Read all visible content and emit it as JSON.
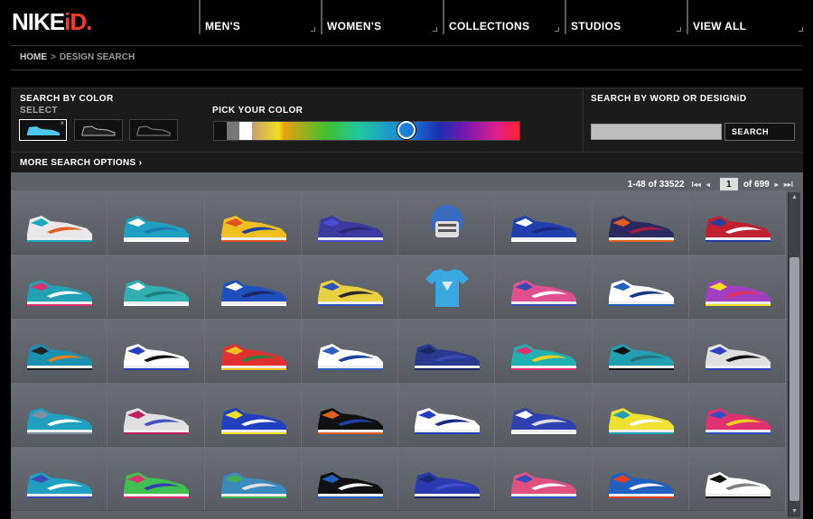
{
  "header": {
    "logo_main": "NIKE",
    "logo_accent": "iD.",
    "nav": [
      "MEN'S",
      "WOMEN'S",
      "COLLECTIONS",
      "STUDIOS",
      "VIEW ALL"
    ]
  },
  "breadcrumb": {
    "home": "HOME",
    "sep": ">",
    "current": "DESIGN SEARCH"
  },
  "search_panel": {
    "color_title": "SEARCH BY COLOR",
    "select_label": "SELECT",
    "swatches": [
      "light-blue-shoe-swatch",
      "grey-shoe-swatch",
      "black-shoe-swatch"
    ],
    "pick_label": "PICK YOUR COLOR",
    "word_title": "SEARCH BY WORD OR DESIGNiD",
    "search_value": "",
    "search_button": "SEARCH",
    "more_options": "MORE SEARCH OPTIONS",
    "more_options_chevron": "›"
  },
  "results": {
    "range": "1-48 of 33522",
    "first_icon": "I◂◂",
    "prev_icon": "◂",
    "page": "1",
    "of_pages": "of 699",
    "next_icon": "▸",
    "last_icon": "▸▸I"
  },
  "products": [
    [
      "#e8e8e8",
      "#1aa8c0",
      "#e06020"
    ],
    [
      "#20a0c0",
      "#ffffff",
      "#1a7fb0"
    ],
    [
      "#f0c020",
      "#e05020",
      "#2040a0"
    ],
    [
      "#3a3aa0",
      "#4c4cd0",
      "#2a2a70"
    ],
    [
      "#c0c8d0",
      "#2060c0",
      "#ffffff"
    ],
    [
      "#2040b0",
      "#ffffff",
      "#1a2a80"
    ],
    [
      "#2a2a60",
      "#e06020",
      "#a02040"
    ],
    [
      "#c02030",
      "#2040a0",
      "#ffffff"
    ],
    [
      "#20a0b0",
      "#e03070",
      "#ffffff"
    ],
    [
      "#30b0b0",
      "#ffffff",
      "#1a8080"
    ],
    [
      "#2050c0",
      "#ffffff",
      "#1a2a60"
    ],
    [
      "#e8d040",
      "#3050c0",
      "#2a2a2a"
    ],
    [
      "#40b0e0",
      "#1a8ac0",
      "#ffffff"
    ],
    [
      "#e05090",
      "#3a4ab0",
      "#ffffff"
    ],
    [
      "#ffffff",
      "#2060c0",
      "#1a3a80"
    ],
    [
      "#a040c0",
      "#f0e020",
      "#e03060"
    ],
    [
      "#1a90b0",
      "#222222",
      "#e08020"
    ],
    [
      "#ffffff",
      "#2a40c0",
      "#111111"
    ],
    [
      "#e03030",
      "#f0c020",
      "#2a8040"
    ],
    [
      "#ffffff",
      "#3060c0",
      "#2040a0"
    ],
    [
      "#2a3a90",
      "#1a2a60",
      "#3a4ab0"
    ],
    [
      "#20b0b0",
      "#e03070",
      "#f0d020"
    ],
    [
      "#20a0b0",
      "#111111",
      "#2a7080"
    ],
    [
      "#e0e0e0",
      "#3040c0",
      "#111111"
    ],
    [
      "#20a0c0",
      "#8090a0",
      "#ffffff"
    ],
    [
      "#e0e0e0",
      "#c02060",
      "#4050c0"
    ],
    [
      "#2040c0",
      "#f0e020",
      "#ffffff"
    ],
    [
      "#111111",
      "#e06020",
      "#2040a0"
    ],
    [
      "#ffffff",
      "#2040c0",
      "#1a2a80"
    ],
    [
      "#3040b0",
      "#ffffff",
      "#e0e0e0"
    ],
    [
      "#f0e030",
      "#20a0b0",
      "#ffffff"
    ],
    [
      "#e03070",
      "#3050c0",
      "#f0d020"
    ],
    [
      "#20a0c0",
      "#3a4ab0",
      "#ffffff"
    ],
    [
      "#40c050",
      "#e03070",
      "#3a3ab0"
    ],
    [
      "#3a8ac0",
      "#40b050",
      "#e0e0e0"
    ],
    [
      "#111111",
      "#2060c0",
      "#ffffff"
    ],
    [
      "#2a3ab0",
      "#1a2a70",
      "#4050d0"
    ],
    [
      "#e05080",
      "#3050c0",
      "#ffffff"
    ],
    [
      "#2060c0",
      "#e04020",
      "#ffffff"
    ],
    [
      "#ffffff",
      "#111111",
      "#808080"
    ]
  ],
  "special_tiles": {
    "4": "helmet",
    "12": "tshirt"
  }
}
